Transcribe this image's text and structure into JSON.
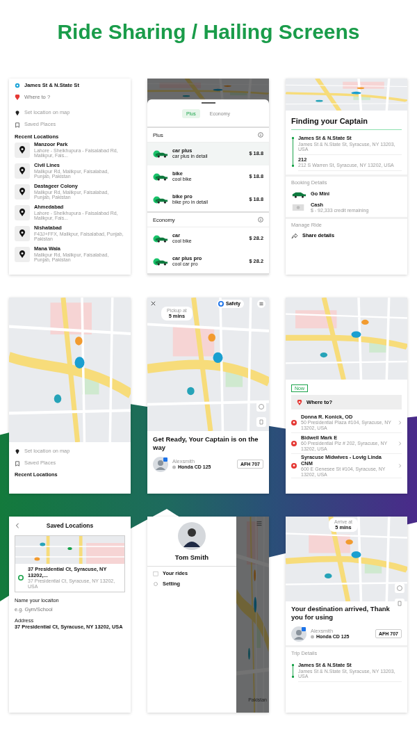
{
  "title": "Ride Sharing / Hailing Screens",
  "screens": [
    {
      "kind": "search",
      "from": "James St & N.State St",
      "to_placeholder": "Where to ?",
      "options": [
        "Set location on map",
        "Saved Places"
      ],
      "section": "Recent Locations",
      "recents": [
        {
          "name": "Manzoor Park",
          "address": "Lahore - Sheikhupura - Faisalabad Rd, Malikpur, Fais..."
        },
        {
          "name": "Civil Lines",
          "address": "Malikpur Rd, Malikpur, Faisalabad, Punjab, Pakistan"
        },
        {
          "name": "Dastageer Colony",
          "address": "Malikpur Rd, Malikpur, Faisalabad, Punjab, Pakistan"
        },
        {
          "name": "Ahmedabad",
          "address": "Lahore - Sheikhupura - Faisalabad Rd, Malikpur, Fais..."
        },
        {
          "name": "Nishatabad",
          "address": "F43J+FFX, Malikpur, Faisalabad, Punjab, Pakistan"
        },
        {
          "name": "Mana Wala",
          "address": "Malikpur Rd, Malikpur, Faisalabad, Punjab, Pakistan"
        }
      ]
    },
    {
      "kind": "ride_options",
      "tabs": [
        {
          "label": "Plus",
          "selected": true
        },
        {
          "label": "Economy",
          "selected": false
        }
      ],
      "groups": [
        {
          "title": "Plus",
          "rides": [
            {
              "name": "car plus",
              "detail": "car plus in detail",
              "price": "$ 18.8",
              "selected": true
            },
            {
              "name": "bike",
              "detail": "cool bike",
              "price": "$ 18.8",
              "selected": false
            },
            {
              "name": "bike pro",
              "detail": "bike pro in detail",
              "price": "$ 18.8",
              "selected": false
            }
          ]
        },
        {
          "title": "Economy",
          "rides": [
            {
              "name": "car",
              "detail": "cool bike",
              "price": "$ 28.2",
              "selected": false
            },
            {
              "name": "car plus pro",
              "detail": "cool car pro",
              "price": "$ 28.2",
              "selected": false
            }
          ]
        }
      ]
    },
    {
      "kind": "finding",
      "heading": "Finding your Captain",
      "stops": [
        {
          "name": "James St & N.State St",
          "address": "James St & N.State St, Syracuse, NY 13203, USA"
        },
        {
          "name": "212",
          "address": "212 S Warren St, Syracuse, NY 13202, USA"
        }
      ],
      "booking_title": "Booking Details",
      "vehicle": "Go Mini",
      "payment": "Cash",
      "credit": "$ - 92,333 credit remaining",
      "manage_title": "Manage Ride",
      "share": "Share details"
    },
    {
      "kind": "map_home",
      "options": [
        "Set location on map",
        "Saved Places"
      ],
      "section": "Recent Locations"
    },
    {
      "kind": "captain",
      "eta_label": "Pickup at",
      "eta": "5 mins",
      "safety": "Safety",
      "heading": "Get Ready, Your Captain is on the way",
      "driver": "Alexsmith",
      "vehicle": "Honda CD 125",
      "plate": "AFH 707"
    },
    {
      "kind": "where_to",
      "badge": "Now",
      "field_label": "Where to?",
      "places": [
        {
          "name": "Donna R. Konick, OD",
          "address": "50 Presidential Plaza #104, Syracuse, NY 13202, USA"
        },
        {
          "name": "Bidwell Mark E",
          "address": "60 Presidential Plz # 202, Syracuse, NY 13202, USA"
        },
        {
          "name": "Syracuse Midwives - Lovig Linda CNM",
          "address": "600 E Genesee St #104, Syracuse, NY 13202, USA"
        }
      ]
    },
    {
      "kind": "saved",
      "heading": "Saved Locations",
      "location": "37 Presidential Ct, Syracuse, NY 13202,...",
      "location_sub": "37 Presidential Ct, Syracuse, NY 13202, USA",
      "name_label": "Name your locaiton",
      "name_placeholder": "e.g. Gym/School",
      "address_label": "Address",
      "address": "37 Presidential Ct, Syracuse, NY 13202, USA"
    },
    {
      "kind": "drawer",
      "user": "Tom Smith",
      "menu": [
        "Your rides",
        "Setting"
      ],
      "behind_text": "Pakistan"
    },
    {
      "kind": "arrived",
      "eta_label": "Arrive at",
      "eta": "5 mins",
      "heading": "Your destination arrived, Thank you for using",
      "driver": "Alexsmith",
      "vehicle": "Honda CD 125",
      "plate": "AFH 707",
      "trip_title": "Trip Details",
      "stops": [
        {
          "name": "James St & N.State St",
          "address": "James St & N.State St, Syracuse, NY 13203, USA"
        }
      ]
    }
  ]
}
